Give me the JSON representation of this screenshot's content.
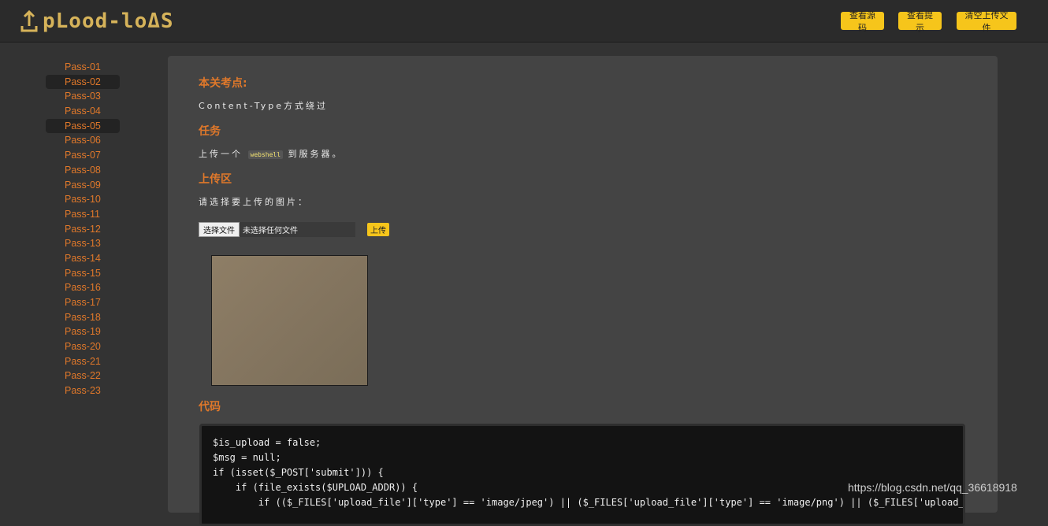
{
  "header": {
    "logo_text": "pLood-loΔS",
    "buttons": {
      "view_source": "查看源码",
      "view_hint": "查看提示",
      "clear_uploads": "清空上传文件"
    }
  },
  "sidebar": {
    "items": [
      {
        "label": "Pass-01"
      },
      {
        "label": "Pass-02"
      },
      {
        "label": "Pass-03"
      },
      {
        "label": "Pass-04"
      },
      {
        "label": "Pass-05"
      },
      {
        "label": "Pass-06"
      },
      {
        "label": "Pass-07"
      },
      {
        "label": "Pass-08"
      },
      {
        "label": "Pass-09"
      },
      {
        "label": "Pass-10"
      },
      {
        "label": "Pass-11"
      },
      {
        "label": "Pass-12"
      },
      {
        "label": "Pass-13"
      },
      {
        "label": "Pass-14"
      },
      {
        "label": "Pass-15"
      },
      {
        "label": "Pass-16"
      },
      {
        "label": "Pass-17"
      },
      {
        "label": "Pass-18"
      },
      {
        "label": "Pass-19"
      },
      {
        "label": "Pass-20"
      },
      {
        "label": "Pass-21"
      },
      {
        "label": "Pass-22"
      },
      {
        "label": "Pass-23"
      }
    ],
    "highlighted": [
      "Pass-02",
      "Pass-05"
    ]
  },
  "main": {
    "key_points_title": "本关考点:",
    "key_points_text": "Content-Type方式绕过",
    "task_title": "任务",
    "task_prefix": "上传一个",
    "task_code": "webshell",
    "task_suffix": "到服务器。",
    "upload_title": "上传区",
    "upload_prompt": "请选择要上传的图片：",
    "choose_button": "选择文件",
    "file_status": "未选择任何文件",
    "upload_button": "上传",
    "code_title": "代码",
    "code_lines": [
      "$is_upload = false;",
      "$msg = null;",
      "if (isset($_POST['submit'])) {",
      "    if (file_exists($UPLOAD_ADDR)) {",
      "        if (($_FILES['upload_file']['type'] == 'image/jpeg') || ($_FILES['upload_file']['type'] == 'image/png') || ($_FILES['upload_file']"
    ]
  },
  "watermark": "https://blog.csdn.net/qq_36618918",
  "colors": {
    "accent_orange": "#e0782a",
    "button_yellow": "#f6c51b",
    "logo_gold": "#d6b35a"
  }
}
